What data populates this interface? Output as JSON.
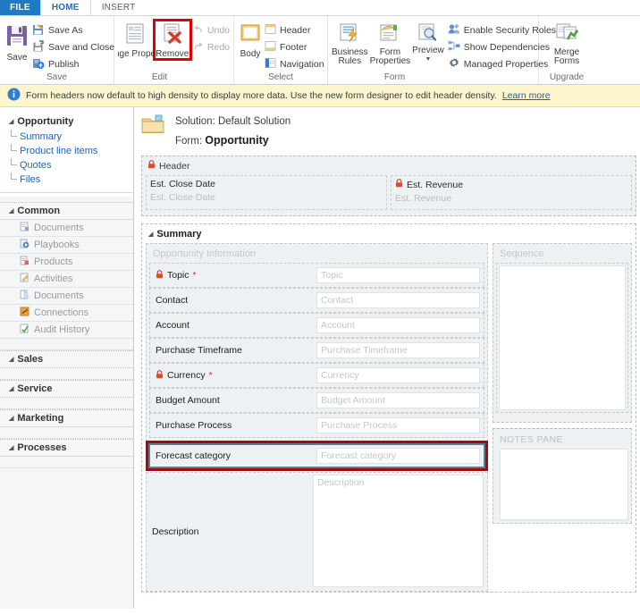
{
  "window": {
    "tabs": [
      {
        "label": "FILE",
        "state": "file"
      },
      {
        "label": "HOME",
        "state": "active"
      },
      {
        "label": "INSERT",
        "state": "inactive"
      }
    ]
  },
  "ribbon": {
    "groups": [
      {
        "title": "Save",
        "big": [
          {
            "label": "Save",
            "icon": "save-floppy-icon"
          }
        ],
        "small": [
          {
            "label": "Save As",
            "icon": "save-as-icon"
          },
          {
            "label": "Save and Close",
            "icon": "save-and-close-icon"
          },
          {
            "label": "Publish",
            "icon": "publish-icon"
          }
        ]
      },
      {
        "title": "Edit",
        "big": [
          {
            "label": "Change Properties",
            "icon": "change-properties-icon"
          },
          {
            "label": "Remove",
            "icon": "remove-icon",
            "highlighted": true
          }
        ],
        "small": [
          {
            "label": "Undo",
            "icon": "undo-icon"
          },
          {
            "label": "Redo",
            "icon": "redo-icon"
          }
        ]
      },
      {
        "title": "Select",
        "big": [
          {
            "label": "Body",
            "icon": "body-icon"
          }
        ],
        "small": [
          {
            "label": "Header",
            "icon": "header-icon"
          },
          {
            "label": "Footer",
            "icon": "footer-icon"
          },
          {
            "label": "Navigation",
            "icon": "navigation-icon"
          }
        ]
      },
      {
        "title": "Form",
        "big": [
          {
            "label": "Business Rules",
            "icon": "business-rules-icon"
          },
          {
            "label": "Form Properties",
            "icon": "form-properties-icon"
          },
          {
            "label": "Preview",
            "icon": "preview-icon",
            "dropdown": true
          }
        ],
        "small": [
          {
            "label": "Enable Security Roles",
            "icon": "enable-security-roles-icon"
          },
          {
            "label": "Show Dependencies",
            "icon": "show-dependencies-icon"
          },
          {
            "label": "Managed Properties",
            "icon": "managed-properties-icon"
          }
        ]
      },
      {
        "title": "Upgrade",
        "big": [
          {
            "label": "Merge Forms",
            "icon": "merge-forms-icon"
          }
        ],
        "small": []
      }
    ]
  },
  "notification": {
    "icon": "info-icon",
    "message": "Form headers now default to high density to display more data. Use the new form designer to edit header density.",
    "link": "Learn more",
    "background": "#fdf5ce"
  },
  "sidebar": {
    "entity": "Opportunity",
    "links": [
      "Summary",
      "Product line items",
      "Quotes",
      "Files"
    ],
    "groups": [
      {
        "label": "Common",
        "items": [
          "Documents",
          "Playbooks",
          "Products",
          "Activities",
          "Documents",
          "Connections",
          "Audit History"
        ]
      },
      {
        "label": "Sales",
        "items": []
      },
      {
        "label": "Service",
        "items": []
      },
      {
        "label": "Marketing",
        "items": []
      },
      {
        "label": "Processes",
        "items": []
      }
    ]
  },
  "canvas": {
    "solution_line": "Solution: Default Solution",
    "form_prefix": "Form:",
    "form_name": "Opportunity",
    "folder_icon": "folder-icon",
    "header_section": {
      "label": "Header",
      "locked": true,
      "fields": [
        {
          "label": "Est. Close Date",
          "placeholder": "Est. Close Date",
          "locked": false
        },
        {
          "label": "Est. Revenue",
          "placeholder": "Est. Revenue",
          "locked": true
        }
      ]
    },
    "summary_section": {
      "label": "Summary",
      "left_panel_title": "Opportunity Information",
      "rows": [
        {
          "label": "Topic",
          "placeholder": "Topic",
          "locked": true,
          "required": true
        },
        {
          "label": "Contact",
          "placeholder": "Contact",
          "locked": false,
          "required": false
        },
        {
          "label": "Account",
          "placeholder": "Account",
          "locked": false,
          "required": false
        },
        {
          "label": "Purchase Timeframe",
          "placeholder": "Purchase Timeframe",
          "locked": false,
          "required": false
        },
        {
          "label": "Currency",
          "placeholder": "Currency",
          "locked": true,
          "required": true
        },
        {
          "label": "Budget Amount",
          "placeholder": "Budget Amount",
          "locked": false,
          "required": false
        },
        {
          "label": "Purchase Process",
          "placeholder": "Purchase Process",
          "locked": false,
          "required": false
        }
      ],
      "selected_row": {
        "label": "Forecast category",
        "placeholder": "Forecast category",
        "outline_color": "#9e0b12",
        "selection_color": "#59818f"
      },
      "description_row": {
        "label": "Description",
        "placeholder": "Description"
      },
      "right_panel_title": "Sequence",
      "notes_pane_title": "NOTES PANE"
    }
  }
}
